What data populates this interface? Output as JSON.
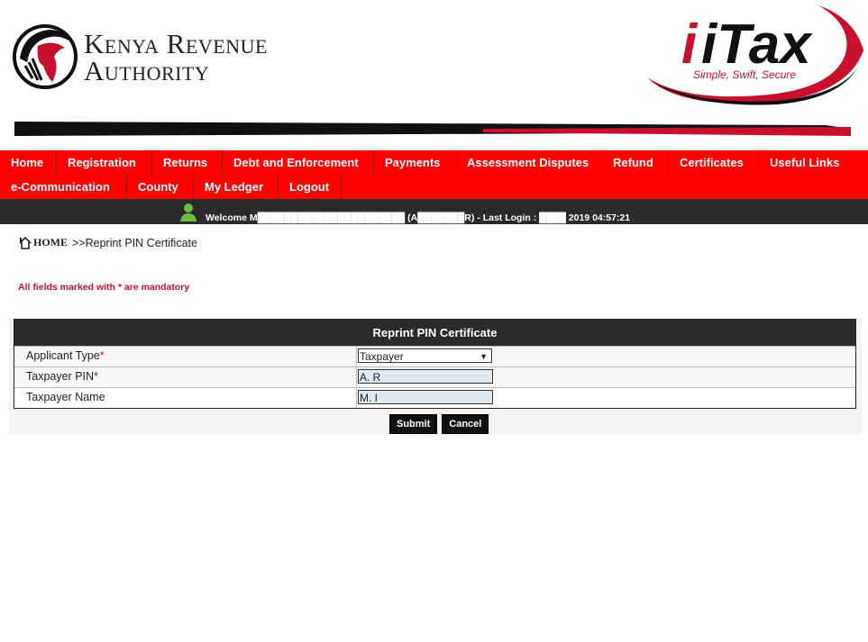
{
  "header": {
    "org_name_line1": "Kenya Revenue",
    "org_name_line2": "Authority",
    "brand": "iTax",
    "tagline": "Simple, Swift, Secure",
    "brand_color": "#c8102e"
  },
  "nav": {
    "row1": [
      "Home",
      "Registration",
      "Returns",
      "Debt and Enforcement",
      "Payments",
      "Assessment Disputes",
      "Refund",
      "Certificates",
      "Useful Links"
    ],
    "row2": [
      "e-Communication",
      "County",
      "My Ledger",
      "Logout"
    ],
    "bg_color": "#ff0000"
  },
  "welcome": {
    "text": "Welcome M██████████████████████ (A███████R)  - Last Login : ████ 2019 04:57:21",
    "user_icon": "user-avatar-icon"
  },
  "breadcrumb": {
    "home": "HOME",
    "current": ">>Reprint PIN Certificate"
  },
  "mandatory_note": "All fields marked with * are mandatory",
  "form": {
    "title": "Reprint PIN Certificate",
    "applicant_type_label": "Applicant Type",
    "applicant_type_value": "Taxpayer",
    "pin_label": "Taxpayer PIN",
    "pin_value": "A.                R",
    "name_label": "Taxpayer Name",
    "name_value": "M.                                   I",
    "required_mark": "*"
  },
  "buttons": {
    "submit": "Submit",
    "cancel": "Cancel"
  }
}
